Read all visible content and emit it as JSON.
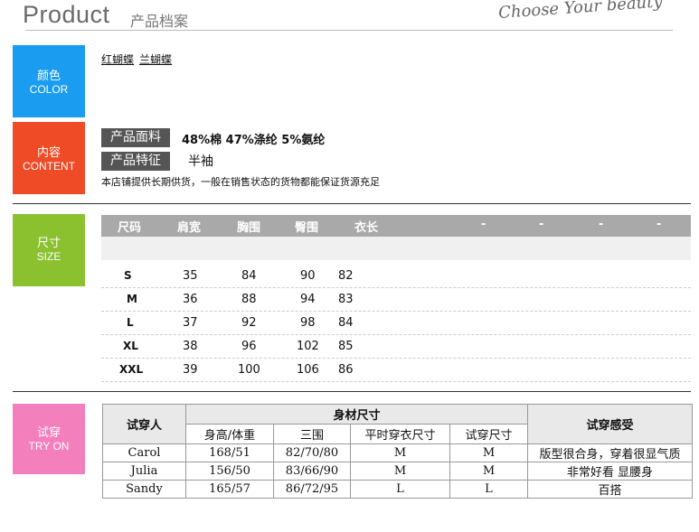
{
  "header": {
    "title_en": "Product",
    "title_cn": "产品档案",
    "slogan": "Choose Your beauty"
  },
  "badges": {
    "color": {
      "cn": "颜色",
      "en": "COLOR"
    },
    "content": {
      "cn": "内容",
      "en": "CONTENT"
    },
    "size": {
      "cn": "尺寸",
      "en": "SIZE"
    },
    "try": {
      "cn": "试穿",
      "en": "TRY ON"
    }
  },
  "colors": [
    "红蝴蝶",
    "兰蝴蝶"
  ],
  "content": {
    "fabric_label": "产品面料",
    "fabric_value": "48%棉 47%涤纶 5%氨纶",
    "feature_label": "产品特征",
    "feature_value": "半袖",
    "note": "本店铺提供长期供货，一般在销售状态的货物都能保证货源充足"
  },
  "size_table": {
    "headers": [
      "尺码",
      "肩宽",
      "胸围",
      "臀围",
      "衣长",
      "-",
      "-",
      "-",
      "-"
    ],
    "rows": [
      {
        "size": "S",
        "shoulder": "35",
        "chest": "84",
        "hip": "90",
        "length": "82"
      },
      {
        "size": "M",
        "shoulder": "36",
        "chest": "88",
        "hip": "94",
        "length": "83"
      },
      {
        "size": "L",
        "shoulder": "37",
        "chest": "92",
        "hip": "98",
        "length": "84"
      },
      {
        "size": "XL",
        "shoulder": "38",
        "chest": "96",
        "hip": "102",
        "length": "85"
      },
      {
        "size": "XXL",
        "shoulder": "39",
        "chest": "100",
        "hip": "106",
        "length": "86"
      }
    ]
  },
  "try_table": {
    "h_person": "试穿人",
    "h_body": "身材尺寸",
    "h_feel": "试穿感受",
    "h_hw": "身高/体重",
    "h_three": "三围",
    "h_usual": "平时穿衣尺寸",
    "h_tried": "试穿尺寸",
    "rows": [
      {
        "name": "Carol",
        "hw": "168/51",
        "three": "82/70/80",
        "usual": "M",
        "tried": "M",
        "feel": "版型很合身，穿着很显气质"
      },
      {
        "name": "Julia",
        "hw": "156/50",
        "three": "83/66/90",
        "usual": "M",
        "tried": "M",
        "feel": "非常好看 显腰身"
      },
      {
        "name": "Sandy",
        "hw": "165/57",
        "three": "86/72/95",
        "usual": "L",
        "tried": "L",
        "feel": "百搭"
      }
    ]
  }
}
